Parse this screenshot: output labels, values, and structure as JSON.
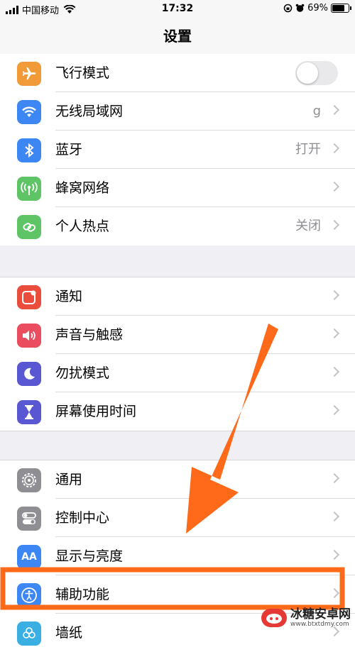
{
  "status_bar": {
    "carrier": "中国移动",
    "time": "17:32",
    "battery": "69%",
    "battery_level": 0.69
  },
  "nav": {
    "title": "设置"
  },
  "groups": [
    {
      "rows": [
        {
          "label": "飞行模式",
          "icon": "airplane-icon",
          "color": "#f19a38",
          "toggle": true,
          "toggle_on": false
        },
        {
          "label": "无线局域网",
          "icon": "wifi-icon",
          "color": "#3d87f5",
          "value": "g"
        },
        {
          "label": "蓝牙",
          "icon": "bluetooth-icon",
          "color": "#3d87f5",
          "value": "打开"
        },
        {
          "label": "蜂窝网络",
          "icon": "cellular-icon",
          "color": "#5ec466",
          "value": ""
        },
        {
          "label": "个人热点",
          "icon": "hotspot-icon",
          "color": "#5ec466",
          "value": "关闭"
        }
      ]
    },
    {
      "rows": [
        {
          "label": "通知",
          "icon": "notifications-icon",
          "color": "#eb4d3d"
        },
        {
          "label": "声音与触感",
          "icon": "sound-icon",
          "color": "#eb4d60"
        },
        {
          "label": "勿扰模式",
          "icon": "moon-icon",
          "color": "#5a57d2"
        },
        {
          "label": "屏幕使用时间",
          "icon": "hourglass-icon",
          "color": "#5a57d2"
        }
      ]
    },
    {
      "rows": [
        {
          "label": "通用",
          "icon": "gear-icon",
          "color": "#8e8e93"
        },
        {
          "label": "控制中心",
          "icon": "toggles-icon",
          "color": "#8e8e93"
        },
        {
          "label": "显示与亮度",
          "icon": "text-size-icon",
          "color": "#3d87f5",
          "icon_text": "AA"
        },
        {
          "label": "辅助功能",
          "icon": "accessibility-icon",
          "color": "#3d87f5"
        },
        {
          "label": "墙纸",
          "icon": "wallpaper-icon",
          "color": "#3ab0e2"
        }
      ]
    }
  ],
  "annotation": {
    "arrow_color": "#ff6a1a",
    "highlight_color": "#ff6a1a"
  },
  "watermark": {
    "title": "冰糖安卓网",
    "url": "www.btxtdmy.com"
  }
}
